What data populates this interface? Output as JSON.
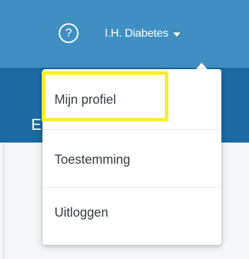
{
  "header": {
    "help_icon_glyph": "?",
    "user_name": "I.H. Diabetes",
    "background_color": "#3f8fc2"
  },
  "subheader": {
    "partial_text": "E",
    "background_color": "#1b6aa1"
  },
  "user_menu": {
    "items": [
      {
        "label": "Mijn profiel"
      },
      {
        "label": "Toestemming"
      },
      {
        "label": "Uitloggen"
      }
    ],
    "highlight_color": "#f7f02e"
  }
}
